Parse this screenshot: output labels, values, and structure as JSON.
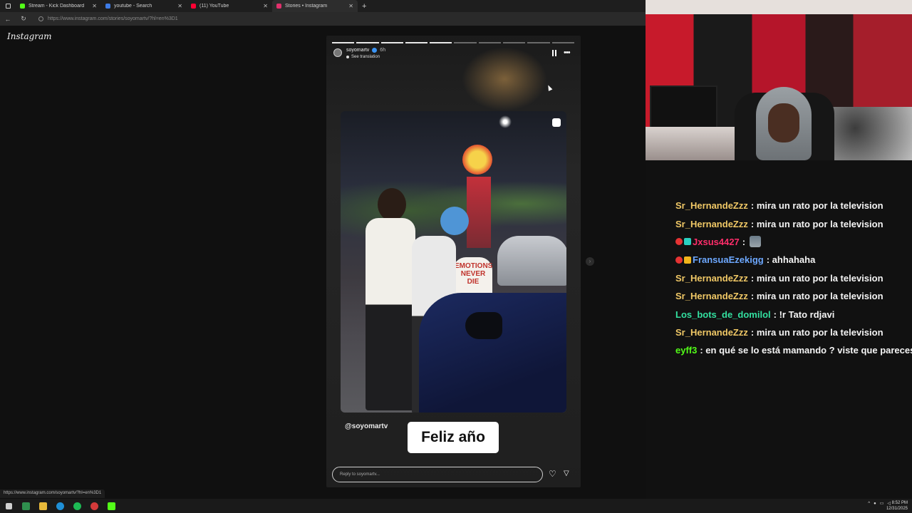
{
  "browser": {
    "tabs": [
      {
        "title": "Stream - Kick Dashboard",
        "color": "#53fc18"
      },
      {
        "title": "youtube - Search",
        "color": "#3d7be6"
      },
      {
        "title": "(11) YouTube",
        "color": "#ff0033"
      },
      {
        "title": "Stories • Instagram",
        "color": "#e1306c"
      }
    ],
    "url": "https://www.instagram.com/stories/soyomartv/?hl=en%3D1",
    "status_url": "https://www.instagram.com/soyomartv/?hl=en%3D1"
  },
  "instagram": {
    "logo": "Instagram",
    "story": {
      "username": "soyomartv",
      "time": "6h",
      "see_translation": "See translation",
      "shirt_text": "EMOTIONS NEVER DIE",
      "mention": "@soyomartv",
      "caption": "Feliz año",
      "reply_placeholder": "Reply to soyomartv..."
    }
  },
  "chat": {
    "messages": [
      {
        "user": "Sr_HernandeZzz",
        "color": "#f0c866",
        "text": ": mira un rato por la television",
        "badges": []
      },
      {
        "user": "Sr_HernandeZzz",
        "color": "#f0c866",
        "text": ": mira un rato por la television",
        "badges": []
      },
      {
        "user": "Jxsus4427",
        "color": "#ff2d6a",
        "text": ":",
        "badges": [
          "#e63333",
          "#2ad0c0"
        ],
        "emote": true
      },
      {
        "user": "FransuaEzekigg",
        "color": "#6da8ff",
        "text": ": ahhahaha",
        "badges": [
          "#e63333",
          "#f2b51b"
        ]
      },
      {
        "user": "Sr_HernandeZzz",
        "color": "#f0c866",
        "text": ": mira un rato por la television",
        "badges": []
      },
      {
        "user": "Sr_HernandeZzz",
        "color": "#f0c866",
        "text": ": mira un rato por la television",
        "badges": []
      },
      {
        "user": "Los_bots_de_domilol",
        "color": "#33e0a0",
        "text": ": !r Tato rdjavi",
        "badges": []
      },
      {
        "user": "Sr_HernandeZzz",
        "color": "#f0c866",
        "text": ": mira un rato por la television",
        "badges": []
      },
      {
        "user": "eyff3",
        "color": "#53fc18",
        "text": ": en qué se lo está mamando ? viste que pareces",
        "badges": []
      }
    ]
  },
  "taskbar": {
    "clock_time": "8:52 PM",
    "clock_date": "12/31/2025"
  }
}
